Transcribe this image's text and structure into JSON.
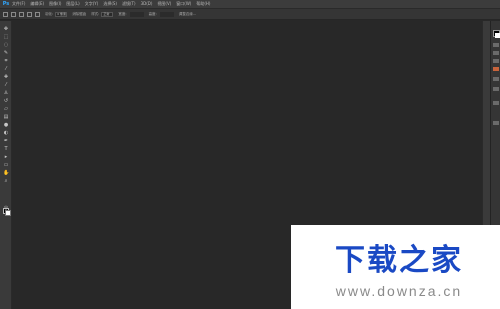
{
  "app": {
    "logo": "Ps"
  },
  "menu": [
    "文件(F)",
    "编辑(E)",
    "图像(I)",
    "图层(L)",
    "文字(Y)",
    "选择(S)",
    "滤镜(T)",
    "3D(D)",
    "视图(V)",
    "窗口(W)",
    "帮助(H)"
  ],
  "options_bar": {
    "feather_label": "羽化:",
    "feather_value": "0 像素",
    "antialias_label": "消除锯齿",
    "style_label": "样式:",
    "style_value": "正常",
    "width_label": "宽度:",
    "height_label": "高度:",
    "refine_label": "调整边缘..."
  },
  "tools": [
    "move-tool",
    "marquee-tool",
    "lasso-tool",
    "quick-select-tool",
    "crop-tool",
    "eyedropper-tool",
    "healing-tool",
    "brush-tool",
    "clone-stamp-tool",
    "history-brush-tool",
    "eraser-tool",
    "gradient-tool",
    "blur-tool",
    "dodge-tool",
    "pen-tool",
    "type-tool",
    "path-select-tool",
    "shape-tool",
    "hand-tool",
    "zoom-tool"
  ],
  "colors": {
    "foreground": "#000000",
    "background": "#ffffff",
    "canvas": "#282828",
    "accent": "#1a49c4"
  },
  "watermark": {
    "title": "下载之家",
    "url": "www.downza.cn"
  }
}
